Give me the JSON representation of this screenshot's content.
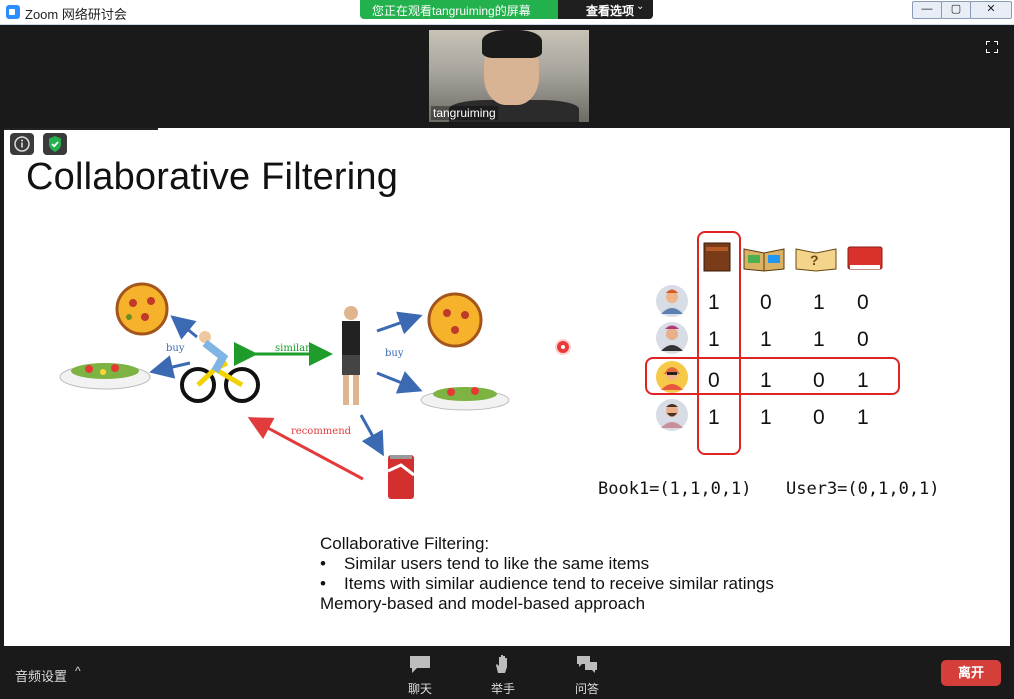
{
  "window": {
    "title": "Zoom 网络研讨会",
    "share_banner": "您正在观看tangruiming的屏幕",
    "view_options": "查看选项",
    "min": "—",
    "max": "▢",
    "close": "✕"
  },
  "video": {
    "participant_name": "tangruiming"
  },
  "slide": {
    "title": "Collaborative Filtering",
    "diagram": {
      "buy_left": "buy",
      "buy_right": "buy",
      "similar": "similar",
      "recommend": "recommend"
    },
    "matrix": {
      "rows": [
        [
          "1",
          "0",
          "1",
          "0"
        ],
        [
          "1",
          "1",
          "1",
          "0"
        ],
        [
          "0",
          "1",
          "0",
          "1"
        ],
        [
          "1",
          "1",
          "0",
          "1"
        ]
      ]
    },
    "book1_vector": "Book1=(1,1,0,1)",
    "user3_vector": "User3=(0,1,0,1)",
    "text": {
      "heading": "Collaborative Filtering:",
      "bullet1": "Similar users tend to like the same items",
      "bullet2": "Items with similar audience tend to receive similar ratings",
      "footer": "Memory-based and model-based approach",
      "bullet_char": "•"
    }
  },
  "toolbar": {
    "audio_settings": "音频设置",
    "audio_chevron": "^",
    "chat": "聊天",
    "raise_hand": "举手",
    "qa": "问答",
    "leave": "离开"
  },
  "colors": {
    "share_green": "#23b14d",
    "leave_red": "#d43f3a",
    "highlight_red": "#e02424",
    "arrow_blue": "#3b6ab3",
    "arrow_green": "#1e9b2a",
    "arrow_red": "#e23b3b"
  }
}
